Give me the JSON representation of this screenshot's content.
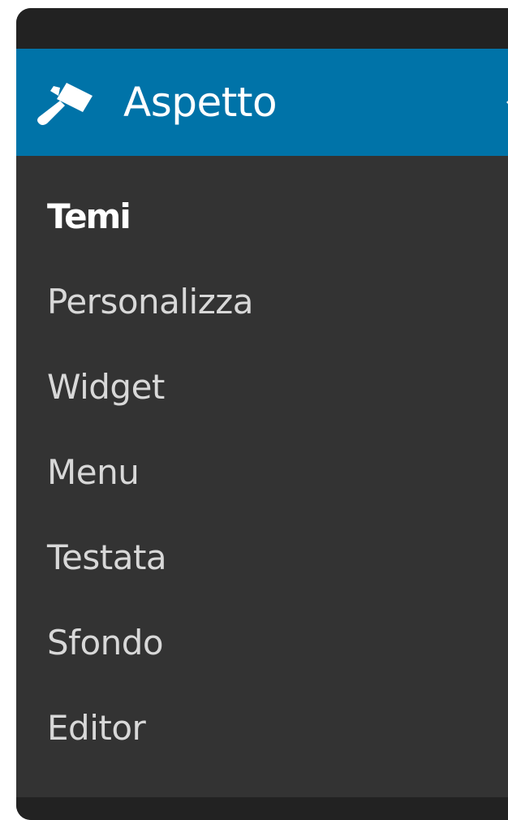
{
  "menu": {
    "header": {
      "icon": "paintbrush-icon",
      "label": "Aspetto"
    },
    "items": [
      {
        "label": "Temi",
        "active": true
      },
      {
        "label": "Personalizza",
        "active": false
      },
      {
        "label": "Widget",
        "active": false
      },
      {
        "label": "Menu",
        "active": false
      },
      {
        "label": "Testata",
        "active": false
      },
      {
        "label": "Sfondo",
        "active": false
      },
      {
        "label": "Editor",
        "active": false
      }
    ]
  },
  "colors": {
    "header_background": "#0073a8",
    "submenu_background": "#333333",
    "frame_background": "#222222",
    "active_text": "#ffffff",
    "inactive_text": "#d8d8d8"
  }
}
